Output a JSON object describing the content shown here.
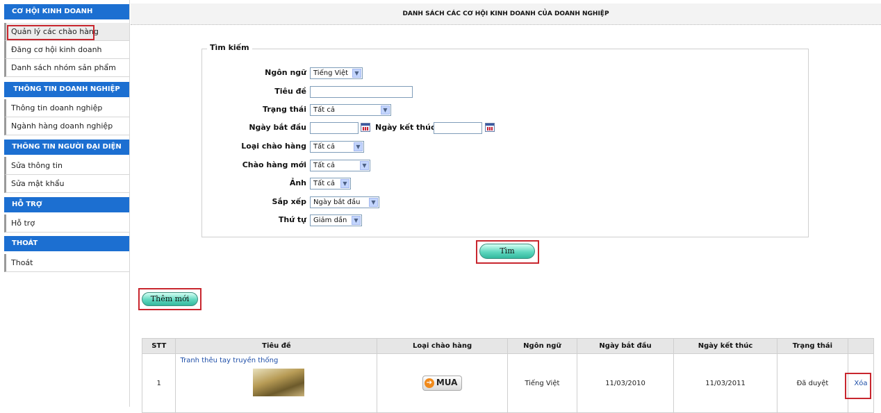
{
  "sidebar": {
    "sections": [
      {
        "title": "CƠ HỘI KINH DOANH",
        "items": [
          "Quản lý các chào hàng",
          "Đăng cơ hội kinh doanh",
          "Danh sách nhóm sản phẩm"
        ]
      },
      {
        "title": "THÔNG TIN DOANH NGHIỆP",
        "items": [
          "Thông tin doanh nghiệp",
          "Ngành hàng doanh nghiệp"
        ]
      },
      {
        "title": "THÔNG TIN NGƯỜI ĐẠI DIỆN",
        "items": [
          "Sửa thông tin",
          "Sửa mật khẩu"
        ]
      },
      {
        "title": "HỖ TRỢ",
        "items": [
          "Hỗ trợ"
        ]
      },
      {
        "title": "THOÁT",
        "items": [
          "Thoát"
        ]
      }
    ]
  },
  "header": {
    "title": "DANH SÁCH CÁC CƠ HỘI KINH DOANH CỦA DOANH NGHIỆP"
  },
  "search": {
    "legend": "Tìm kiếm",
    "language_label": "Ngôn ngữ",
    "language_value": "Tiếng Việt",
    "title_label": "Tiêu đề",
    "title_value": "",
    "status_label": "Trạng thái",
    "status_value": "Tất cả",
    "start_date_label": "Ngày bắt đầu",
    "end_date_label": "Ngày kết thúc",
    "offer_type_label": "Loại chào hàng",
    "offer_type_value": "Tất cả",
    "new_offer_label": "Chào hàng mới",
    "new_offer_value": "Tất cả",
    "image_label": "Ảnh",
    "image_value": "Tất cả",
    "sort_label": "Sắp xếp",
    "sort_value": "Ngày bắt đầu",
    "order_label": "Thứ tự",
    "order_value": "Giảm dần",
    "submit_label": "Tìm"
  },
  "add_button_label": "Thêm mới",
  "table": {
    "headers": [
      "STT",
      "Tiêu đề",
      "Loại chào hàng",
      "Ngôn ngữ",
      "Ngày bắt đầu",
      "Ngày kết thúc",
      "Trạng thái",
      ""
    ],
    "rows": [
      {
        "stt": "1",
        "title": "Tranh thêu tay truyền thống",
        "offer_type": "MUA",
        "language": "Tiếng Việt",
        "start_date": "11/03/2010",
        "end_date": "11/03/2011",
        "status": "Đã duyệt",
        "action": "Xóa"
      }
    ]
  }
}
